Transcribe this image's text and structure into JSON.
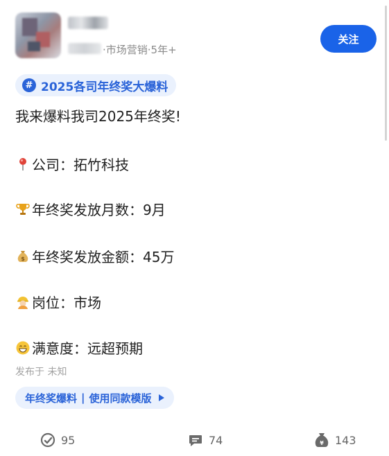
{
  "author": {
    "meta": "·市场营销·5年+",
    "follow_label": "关注"
  },
  "topic": {
    "icon": "hash-icon",
    "label": "2025各司年终奖大爆料"
  },
  "post": {
    "title": "我来爆料我司2025年终奖!",
    "lines": [
      {
        "icon": "pushpin-icon",
        "text": "公司：拓竹科技"
      },
      {
        "icon": "trophy-icon",
        "text": "年终奖发放月数：9月"
      },
      {
        "icon": "money-bag-icon",
        "text": "年终奖发放金额：45万"
      },
      {
        "icon": "worker-icon",
        "text": "岗位：市场"
      },
      {
        "icon": "grinning-face-icon",
        "text": "满意度：远超预期"
      }
    ],
    "published": "发布于 未知"
  },
  "template_chip": {
    "left": "年终奖爆料",
    "sep": "|",
    "right": "使用同款模版"
  },
  "actions": {
    "like_count": "95",
    "comment_count": "74",
    "reward_count": "143"
  },
  "colors": {
    "accent": "#1a63e8",
    "tag_bg": "#eaf1fd",
    "tag_text": "#2a63d8"
  }
}
